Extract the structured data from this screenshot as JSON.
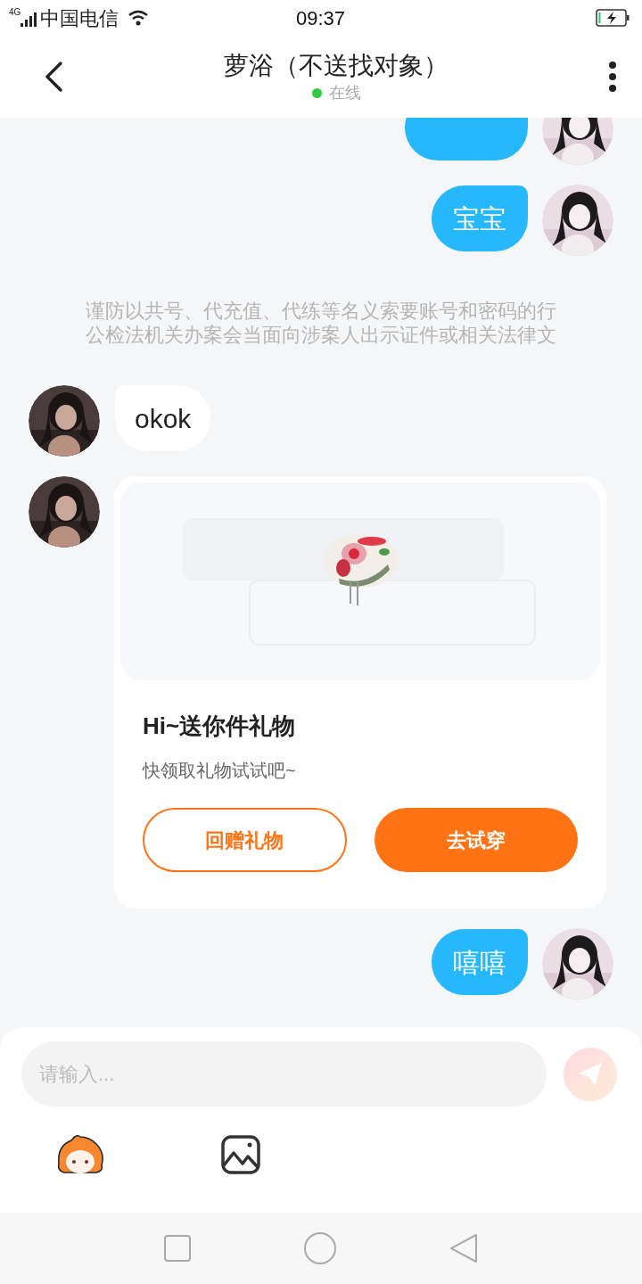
{
  "status_bar": {
    "network": "4G",
    "carrier": "中国电信",
    "time": "09:37"
  },
  "header": {
    "title": "萝浴（不送找对象）",
    "status": "在线",
    "online": true
  },
  "messages": [
    {
      "kind": "text",
      "outgoing": true
    },
    {
      "kind": "text",
      "outgoing": true,
      "text": "宝宝"
    },
    {
      "kind": "notice",
      "lines": [
        "谨防以共号、代充值、代练等名义索要账号和密码的行",
        "公检法机关办案会当面向涉案人出示证件或相关法律文"
      ]
    },
    {
      "kind": "text",
      "outgoing": false,
      "text": "okok"
    },
    {
      "kind": "gift",
      "outgoing": false,
      "title": "Hi~送你件礼物",
      "subtitle": "快领取礼物试试吧~",
      "buttons": [
        {
          "label": "回赠礼物",
          "kind": "outline"
        },
        {
          "label": "去试穿",
          "kind": "filled"
        }
      ]
    },
    {
      "kind": "text",
      "outgoing": true,
      "text": "嘻嘻"
    }
  ],
  "composer": {
    "placeholder": "请输入..."
  }
}
